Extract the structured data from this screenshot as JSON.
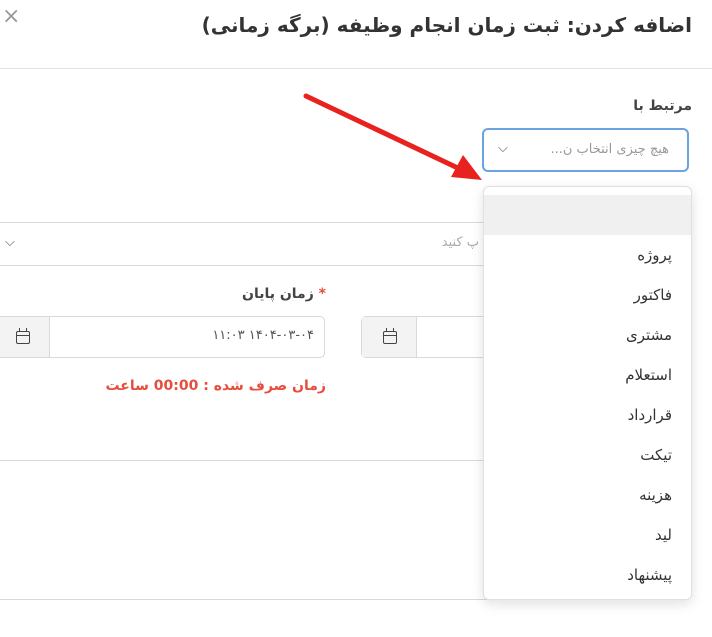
{
  "dialog": {
    "title": "اضافه کردن: ثبت زمان انجام وظیفه (برگه زمانی)",
    "close_icon": "×"
  },
  "related": {
    "label": "مرتبط با",
    "placeholder": "هیچ چیزی انتخاب ن...",
    "chevron": "⌵"
  },
  "task_select": {
    "placeholder": "پ کنید",
    "chevron": "⌵"
  },
  "end_time": {
    "required_mark": "*",
    "label": "زمان پایان",
    "value": "۱۱:۰۳ ۱۴۰۴-۰۳-۰۴"
  },
  "duration_text": "زمان صرف شده : 00:00 ساعت",
  "dropdown_options": [
    "",
    "پروژه",
    "فاکتور",
    "مشتری",
    "استعلام",
    "قرارداد",
    "تیکت",
    "هزینه",
    "لید",
    "پیشنهاد"
  ],
  "colors": {
    "accent_border": "#6aa3df",
    "arrow": "#e8231f",
    "required": "#e74c3c"
  }
}
